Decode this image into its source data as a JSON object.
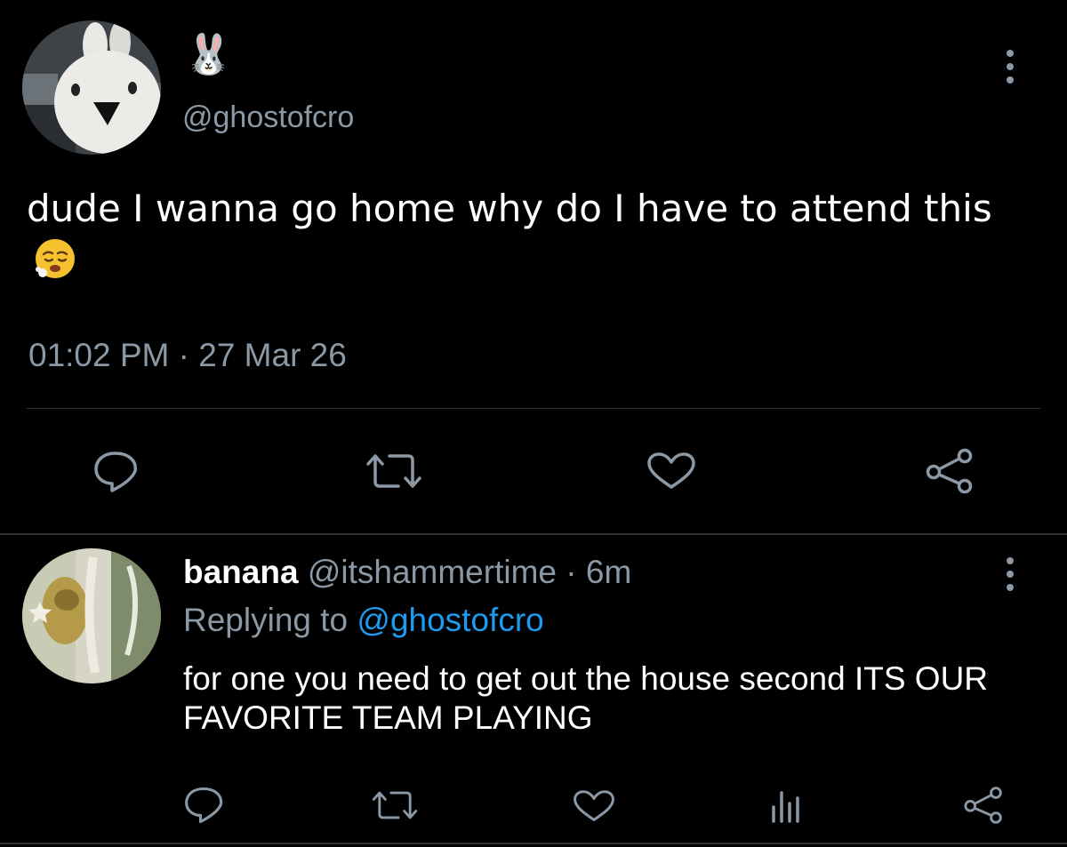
{
  "main_tweet": {
    "display_name": "🐰",
    "handle": "@ghostofcro",
    "text": "dude I wanna go home why do I have to attend this",
    "emoji_icon": "tired-face-emoji",
    "timestamp": "01:02 PM · 27 Mar 26",
    "actions": [
      "reply-icon",
      "retweet-icon",
      "like-icon",
      "share-icon"
    ]
  },
  "reply_tweet": {
    "display_name": "banana",
    "handle": "@itshammertime",
    "separator": " · ",
    "time_ago": "6m",
    "replying_prefix": "Replying to ",
    "replying_to": "@ghostofcro",
    "text": "for one you need to get out the house second ITS OUR FAVORITE TEAM PLAYING",
    "actions": [
      "reply-icon",
      "retweet-icon",
      "like-icon",
      "analytics-icon",
      "share-icon"
    ]
  },
  "colors": {
    "background": "#000000",
    "text": "#ffffff",
    "secondary": "#8b98a5",
    "link": "#1d9bf0",
    "divider": "#2f3336"
  }
}
